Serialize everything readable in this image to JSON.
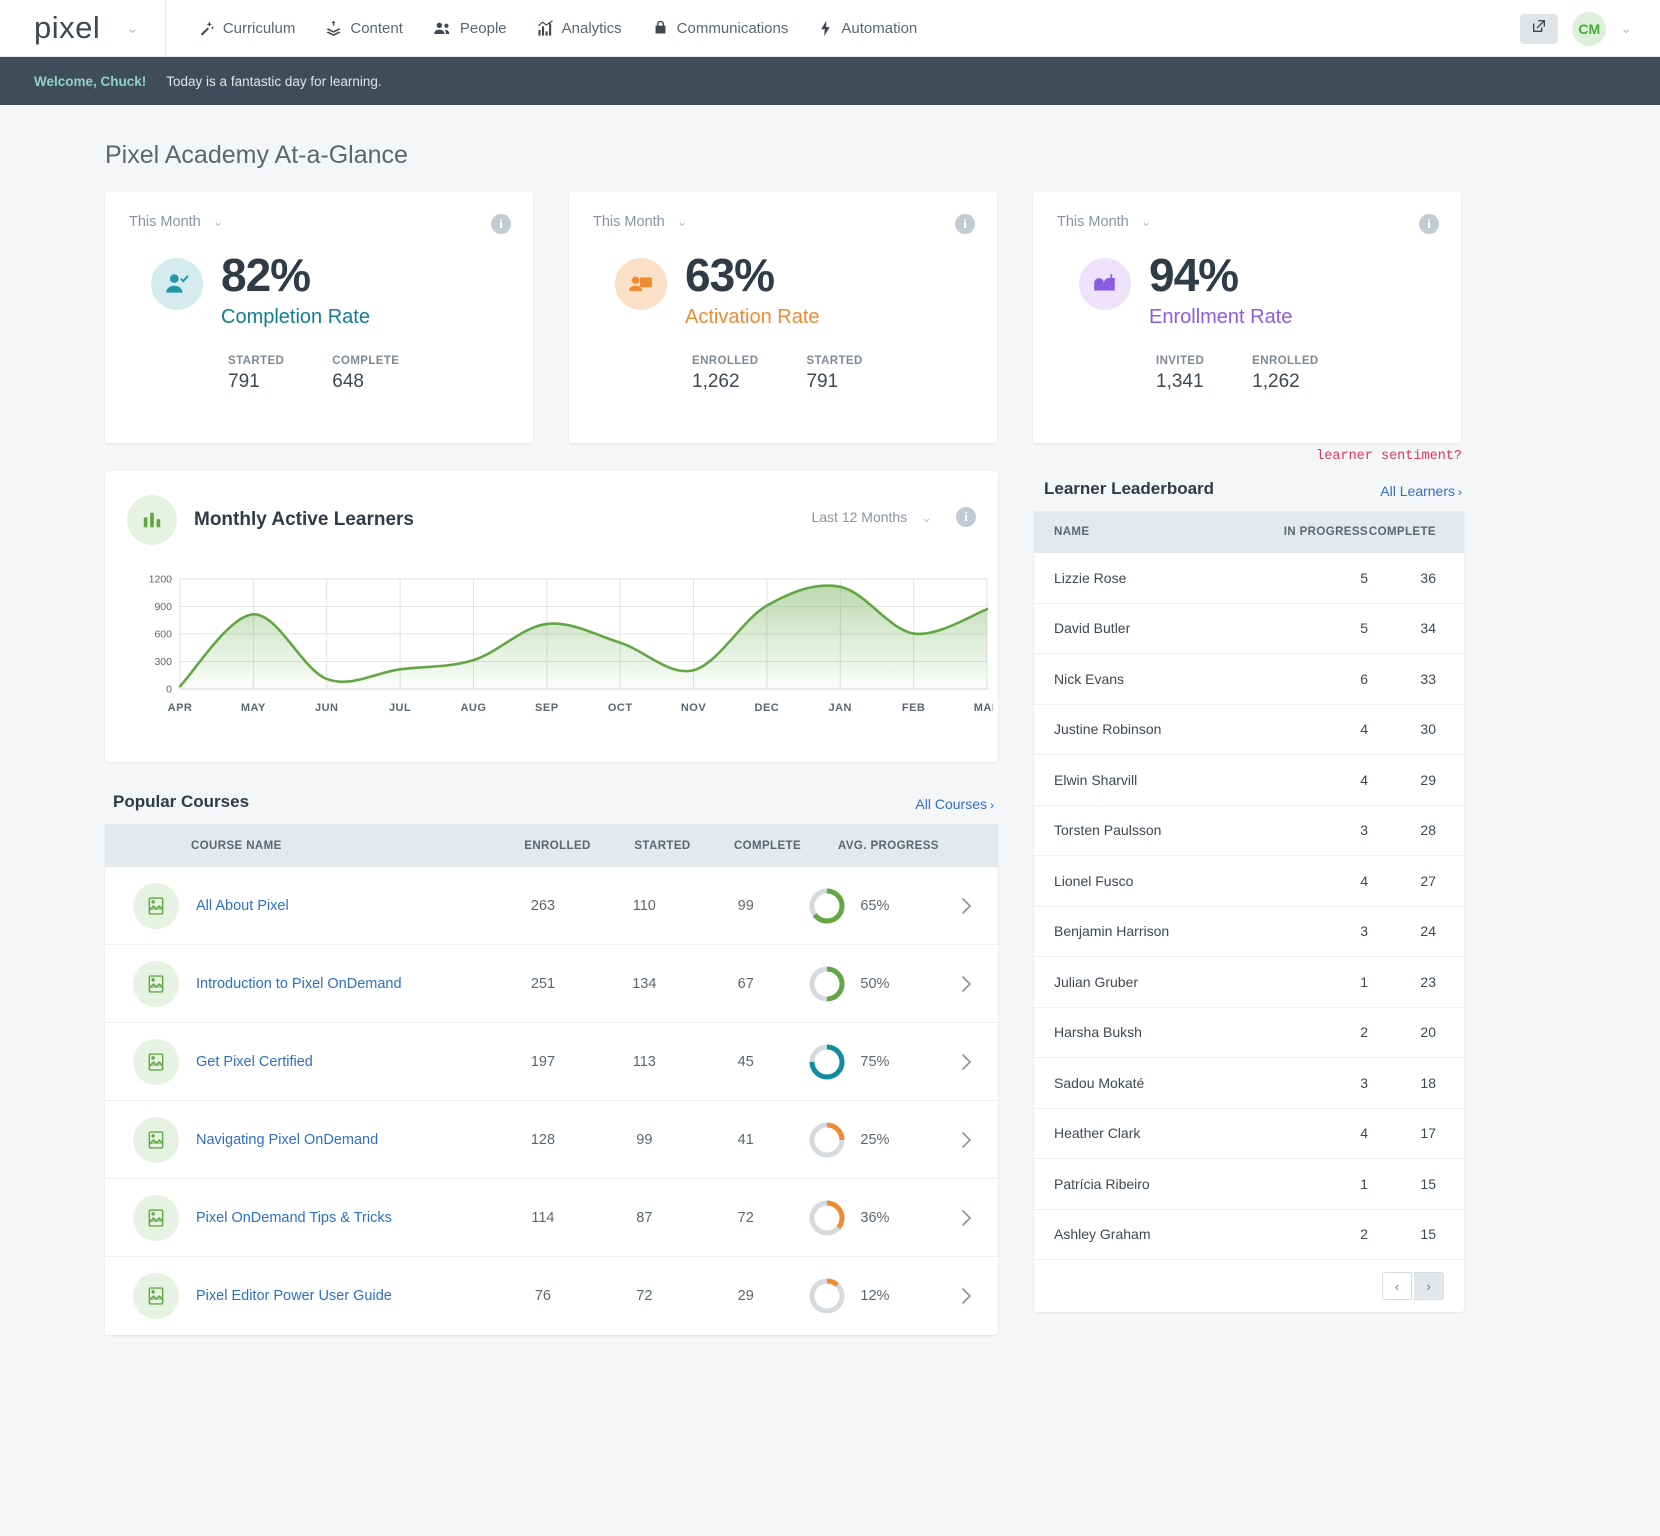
{
  "header": {
    "logo": "pixel",
    "logo_caret": "⌄",
    "nav": [
      {
        "label": "Curriculum",
        "icon": "magic-wand-icon"
      },
      {
        "label": "Content",
        "icon": "layers-icon"
      },
      {
        "label": "People",
        "icon": "people-icon"
      },
      {
        "label": "Analytics",
        "icon": "analytics-icon"
      },
      {
        "label": "Communications",
        "icon": "envelope-icon"
      },
      {
        "label": "Automation",
        "icon": "lightning-icon"
      }
    ],
    "external_link_icon": "external-link-icon",
    "avatar_initials": "CM",
    "avatar_caret": "⌄"
  },
  "welcome": {
    "title": "Welcome, Chuck!",
    "subtitle": "Today is a fantastic day for learning."
  },
  "page": {
    "title": "Pixel Academy At-a-Glance"
  },
  "stats": [
    {
      "period": "This Month",
      "percent": "82%",
      "label": "Completion Rate",
      "label_color": "#0f7f90",
      "icon": "user-check-icon",
      "icon_bg": "#d5ecef",
      "icon_color": "#2295a6",
      "sub": [
        {
          "key": "STARTED",
          "value": "791"
        },
        {
          "key": "COMPLETE",
          "value": "648"
        }
      ]
    },
    {
      "period": "This Month",
      "percent": "63%",
      "label": "Activation Rate",
      "label_color": "#ef8b33",
      "icon": "presenter-icon",
      "icon_bg": "#fae0c6",
      "icon_color": "#ef8b33",
      "sub": [
        {
          "key": "ENROLLED",
          "value": "1,262"
        },
        {
          "key": "STARTED",
          "value": "791"
        }
      ]
    },
    {
      "period": "This Month",
      "percent": "94%",
      "label": "Enrollment Rate",
      "label_color": "#8b5ce0",
      "icon": "mailbox-icon",
      "icon_bg": "#eee2fb",
      "icon_color": "#8b5ce0",
      "sub": [
        {
          "key": "INVITED",
          "value": "1,341"
        },
        {
          "key": "ENROLLED",
          "value": "1,262"
        }
      ]
    }
  ],
  "chart_card": {
    "title": "Monthly Active Learners",
    "icon": "bar-chart-icon",
    "period": "Last 12 Months",
    "period_caret": "⌄",
    "info_icon": "info-icon"
  },
  "chart_data": {
    "type": "area",
    "title": "Monthly Active Learners",
    "xlabel": "",
    "ylabel": "",
    "categories": [
      "APR",
      "MAY",
      "JUN",
      "JUL",
      "AUG",
      "SEP",
      "OCT",
      "NOV",
      "DEC",
      "JAN",
      "FEB",
      "MAR"
    ],
    "values": [
      30,
      815,
      110,
      215,
      315,
      710,
      505,
      205,
      910,
      1115,
      605,
      870
    ],
    "ylim": [
      0,
      1200
    ],
    "yticks": [
      0,
      300,
      600,
      900,
      1200
    ],
    "grid": true,
    "legend": "none",
    "line_color": "#62a744",
    "fill_color": "#62a744"
  },
  "popular_courses": {
    "title": "Popular Courses",
    "all_link": "All Courses",
    "all_link_chevron": "›",
    "columns": [
      "COURSE NAME",
      "ENROLLED",
      "STARTED",
      "COMPLETE",
      "AVG. PROGRESS"
    ],
    "rows": [
      {
        "name": "All About Pixel",
        "enrolled": "263",
        "started": "110",
        "complete": "99",
        "progress": "65%",
        "progress_value": 65,
        "ring_color": "#62a744",
        "thumb_icon": "image-icon",
        "row_chevron": "›"
      },
      {
        "name": "Introduction to Pixel OnDemand",
        "enrolled": "251",
        "started": "134",
        "complete": "67",
        "progress": "50%",
        "progress_value": 50,
        "ring_color": "#62a744",
        "thumb_icon": "image-icon",
        "row_chevron": "›"
      },
      {
        "name": "Get Pixel Certified",
        "enrolled": "197",
        "started": "113",
        "complete": "45",
        "progress": "75%",
        "progress_value": 75,
        "ring_color": "#0f8ca0",
        "thumb_icon": "image-icon",
        "row_chevron": "›"
      },
      {
        "name": "Navigating Pixel OnDemand",
        "enrolled": "128",
        "started": "99",
        "complete": "41",
        "progress": "25%",
        "progress_value": 25,
        "ring_color": "#ef8b33",
        "thumb_icon": "image-icon",
        "row_chevron": "›"
      },
      {
        "name": "Pixel OnDemand Tips & Tricks",
        "enrolled": "114",
        "started": "87",
        "complete": "72",
        "progress": "36%",
        "progress_value": 36,
        "ring_color": "#ef8b33",
        "thumb_icon": "image-icon",
        "row_chevron": "›"
      },
      {
        "name": "Pixel Editor Power User Guide",
        "enrolled": "76",
        "started": "72",
        "complete": "29",
        "progress": "12%",
        "progress_value": 12,
        "ring_color": "#ef8b33",
        "thumb_icon": "image-icon",
        "row_chevron": "›"
      }
    ]
  },
  "leaderboard": {
    "sentiment_note": "learner sentiment?",
    "title": "Learner Leaderboard",
    "all_link": "All Learners",
    "all_link_chevron": "›",
    "columns": [
      "NAME",
      "IN PROGRESS",
      "COMPLETE"
    ],
    "rows": [
      {
        "name": "Lizzie Rose",
        "in_progress": "5",
        "complete": "36"
      },
      {
        "name": "David Butler",
        "in_progress": "5",
        "complete": "34"
      },
      {
        "name": "Nick Evans",
        "in_progress": "6",
        "complete": "33"
      },
      {
        "name": "Justine Robinson",
        "in_progress": "4",
        "complete": "30"
      },
      {
        "name": "Elwin Sharvill",
        "in_progress": "4",
        "complete": "29"
      },
      {
        "name": "Torsten Paulsson",
        "in_progress": "3",
        "complete": "28"
      },
      {
        "name": "Lionel Fusco",
        "in_progress": "4",
        "complete": "27"
      },
      {
        "name": "Benjamin Harrison",
        "in_progress": "3",
        "complete": "24"
      },
      {
        "name": "Julian Gruber",
        "in_progress": "1",
        "complete": "23"
      },
      {
        "name": "Harsha Buksh",
        "in_progress": "2",
        "complete": "20"
      },
      {
        "name": "Sadou Mokaté",
        "in_progress": "3",
        "complete": "18"
      },
      {
        "name": "Heather Clark",
        "in_progress": "4",
        "complete": "17"
      },
      {
        "name": "Patrícia Ribeiro",
        "in_progress": "1",
        "complete": "15"
      },
      {
        "name": "Ashley Graham",
        "in_progress": "2",
        "complete": "15"
      }
    ],
    "pagination": {
      "prev": "‹",
      "next": "›"
    }
  }
}
